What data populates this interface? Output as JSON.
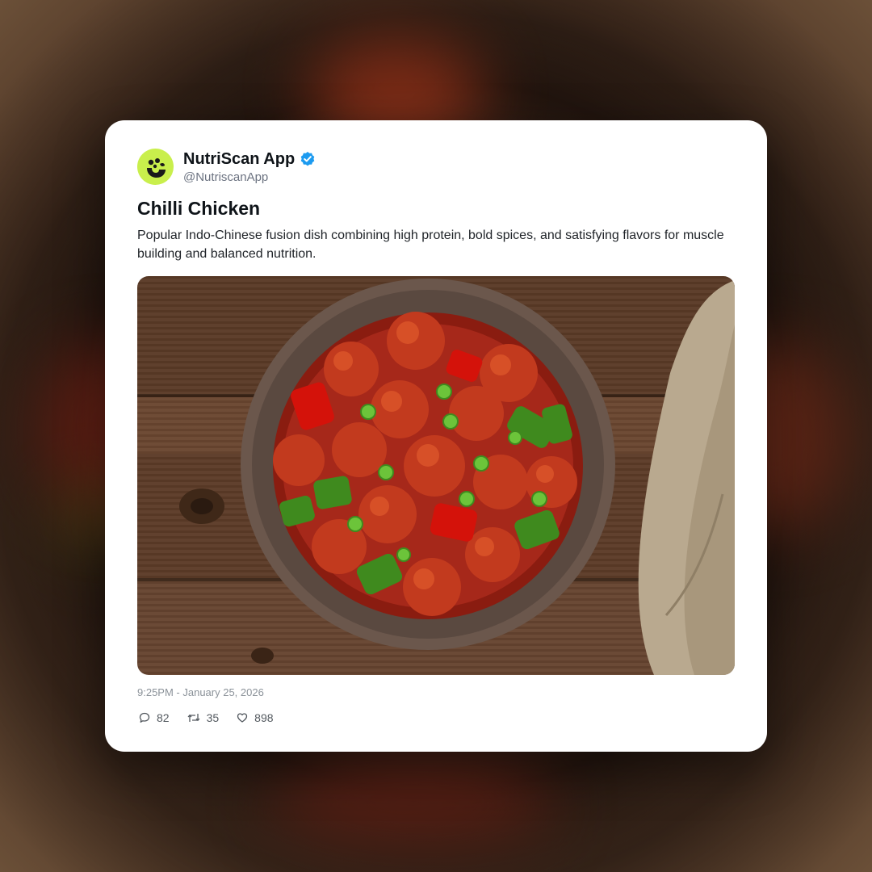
{
  "post": {
    "display_name": "NutriScan App",
    "handle": "@NutriscanApp",
    "verified": true,
    "title": "Chilli Chicken",
    "description": "Popular Indo-Chinese fusion dish combining high protein, bold spices, and satisfying flavors for muscle building and balanced nutrition.",
    "timestamp": "9:25PM - January 25, 2026",
    "stats": {
      "replies": "82",
      "reposts": "35",
      "likes": "898"
    }
  },
  "icons": {
    "avatar": "nutriscan-logo-icon",
    "verified": "verified-badge-icon",
    "reply": "comment-icon",
    "repost": "repost-icon",
    "like": "heart-icon"
  },
  "colors": {
    "avatar_bg": "#c9ef4c",
    "verified_blue": "#1d9bf0",
    "card_bg": "#ffffff"
  }
}
